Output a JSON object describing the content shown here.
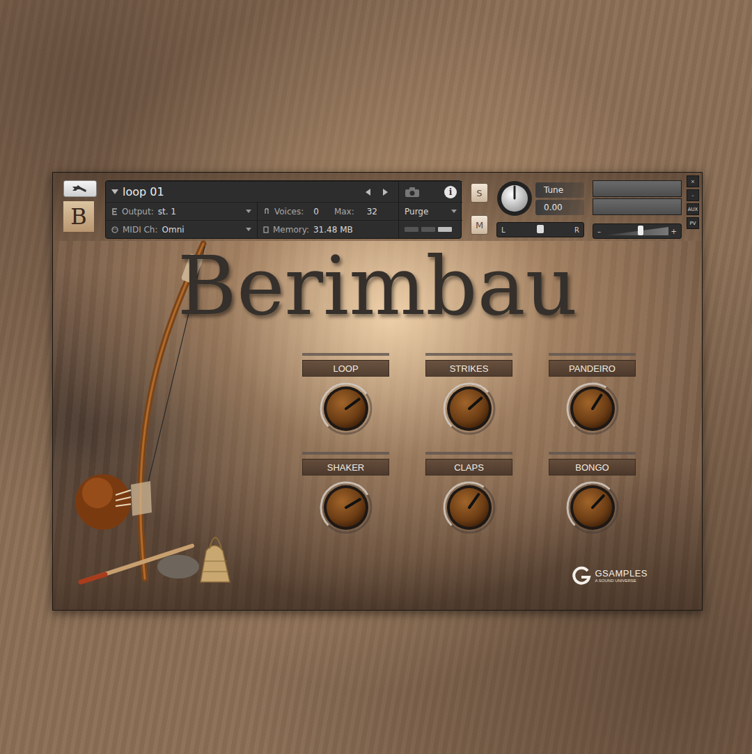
{
  "header": {
    "logo_letter": "B",
    "instrument_name": "loop 01",
    "info": "i",
    "output": {
      "label": "Output:",
      "value": "st. 1"
    },
    "midi": {
      "label": "MIDI Ch:",
      "value": "Omni"
    },
    "voices": {
      "label": "Voices:",
      "value": "0"
    },
    "max": {
      "label": "Max:",
      "value": "32"
    },
    "memory": {
      "label": "Memory:",
      "value": "31.48 MB"
    },
    "purge": "Purge",
    "solo": {
      "label": "S",
      "on": false
    },
    "mute": {
      "label": "M",
      "on": false
    },
    "tune": {
      "label": "Tune",
      "value": "0.00",
      "level": 0.5
    },
    "pan": {
      "left": "L",
      "right": "R",
      "level": 0.5
    },
    "meters": [
      {
        "level": 0
      },
      {
        "level": 0
      }
    ],
    "volume": {
      "minus": "–",
      "plus": "+",
      "level": 0.55
    },
    "side_buttons": [
      "×",
      "–",
      "AUX",
      "PV"
    ]
  },
  "panel": {
    "title": "Berimbau",
    "knobs": [
      {
        "label": "LOOP",
        "level": 0.7
      },
      {
        "label": "STRIKES",
        "level": 0.68
      },
      {
        "label": "PANDEIRO",
        "level": 0.62
      },
      {
        "label": "SHAKER",
        "level": 0.72
      },
      {
        "label": "CLAPS",
        "level": 0.63
      },
      {
        "label": "BONGO",
        "level": 0.66
      }
    ],
    "brand": "GSAMPLES",
    "brand_tagline": "A SOUND UNIVERSE"
  }
}
